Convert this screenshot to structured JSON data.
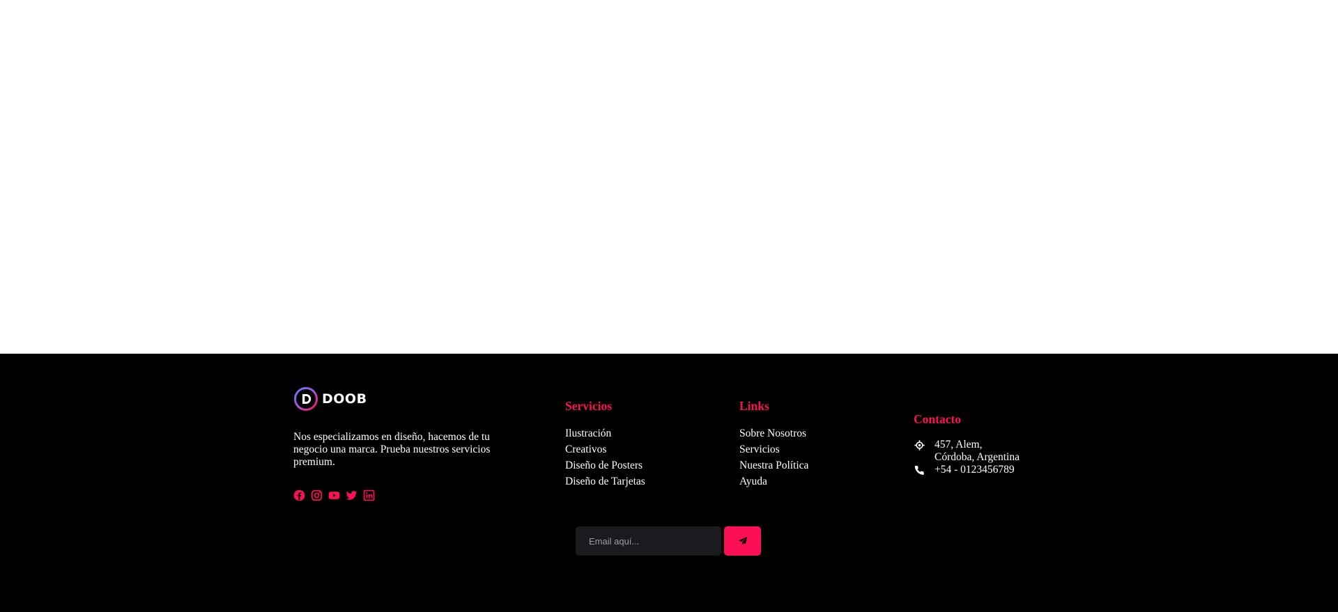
{
  "footer": {
    "brand": {
      "logo_text": "DOOB",
      "logo_icon": "doob-logo-mark",
      "description": "Nos especializamos en diseño, hacemos de tu negocio una marca. Prueba nuestros servicios premium.",
      "socials": [
        {
          "icon": "facebook-icon"
        },
        {
          "icon": "instagram-icon"
        },
        {
          "icon": "youtube-icon"
        },
        {
          "icon": "twitter-icon"
        },
        {
          "icon": "linkedin-icon"
        }
      ]
    },
    "servicios": {
      "title": "Servicios",
      "items": [
        "Ilustración",
        "Creativos",
        "Diseño de Posters",
        "Diseño de Tarjetas"
      ]
    },
    "links": {
      "title": "Links",
      "items": [
        "Sobre Nosotros",
        "Servicios",
        "Nuestra Política",
        "Ayuda"
      ]
    },
    "contacto": {
      "title": "Contacto",
      "address_line1": "457, Alem,",
      "address_line2": "Córdoba, Argentina",
      "phone": "+54 - 0123456789",
      "address_icon": "location-crosshair-icon",
      "phone_icon": "phone-icon"
    },
    "newsletter": {
      "placeholder": "Email aquí...",
      "value": "",
      "button_icon": "paper-plane-icon"
    }
  },
  "colors": {
    "accent": "#fd0f57",
    "footer_bg": "#010001",
    "input_bg": "#1b1b1f",
    "text": "#ffffff"
  }
}
